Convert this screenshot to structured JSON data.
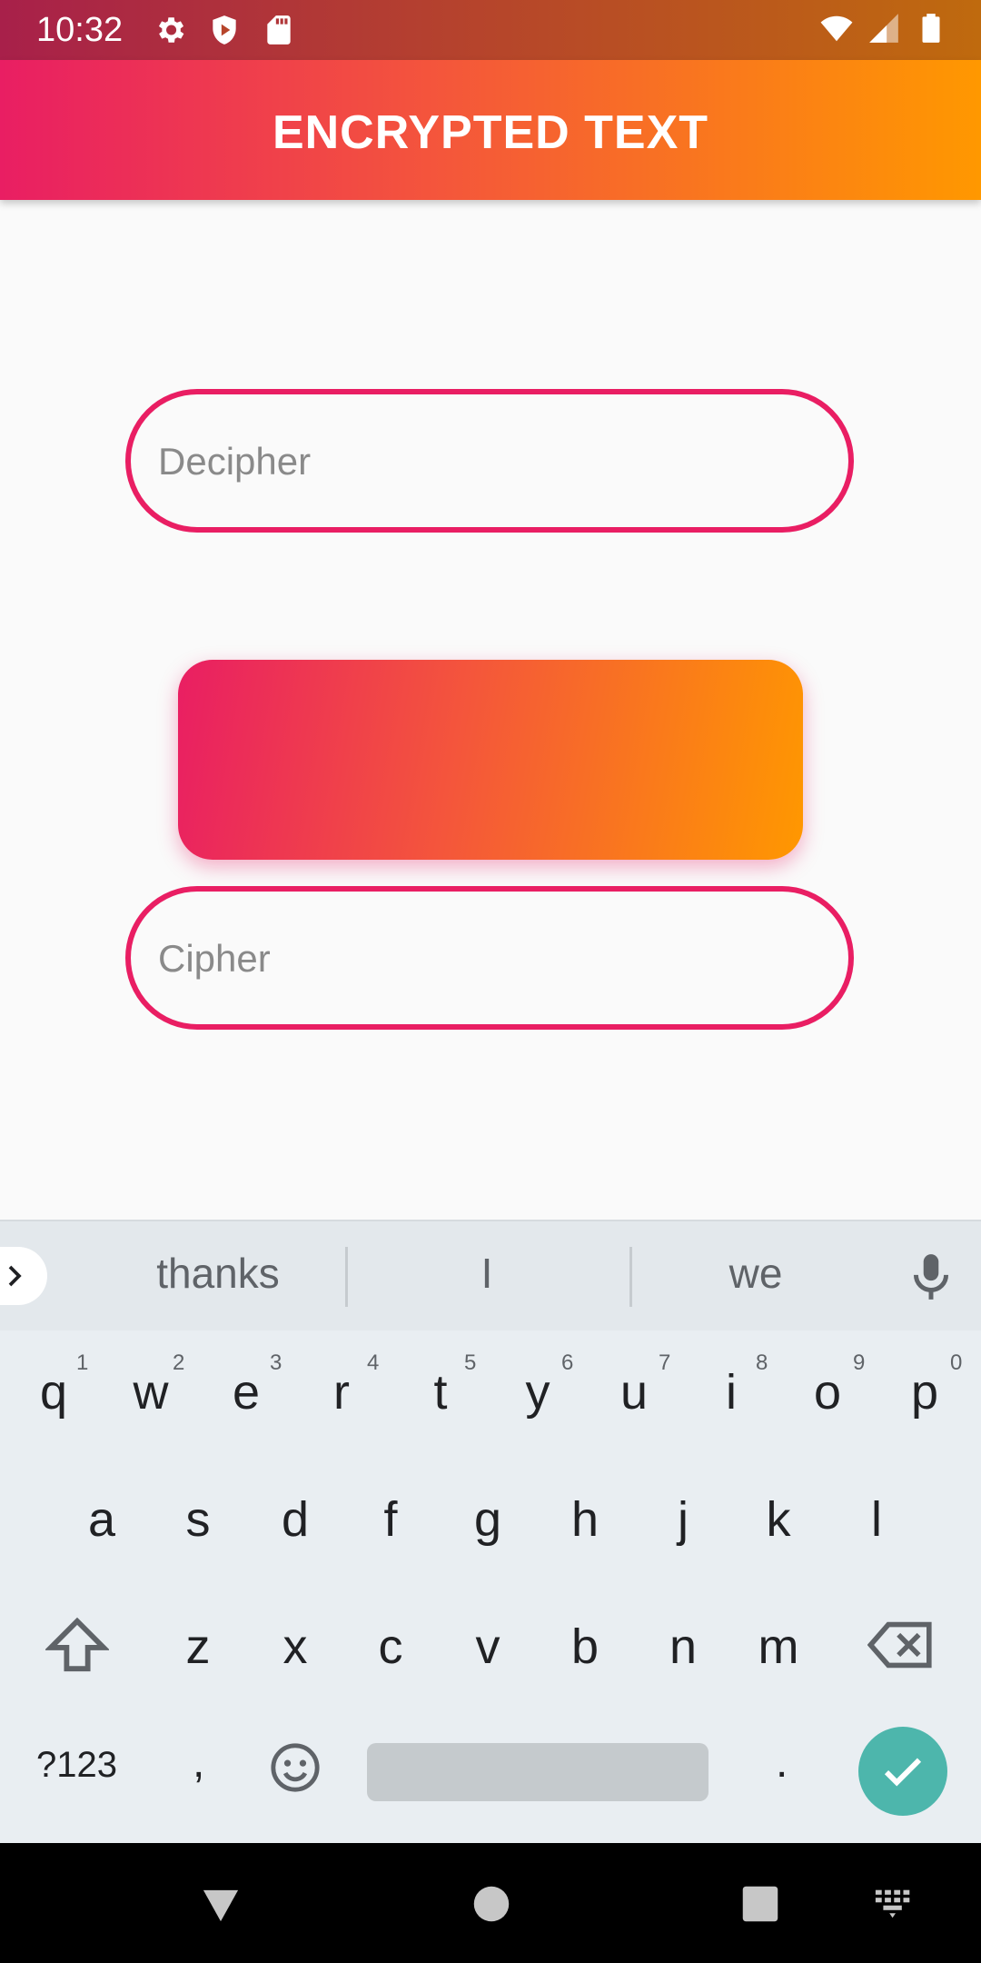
{
  "status_bar": {
    "time": "10:32",
    "icons_left": [
      "settings-icon",
      "shield-play-icon",
      "sd-card-icon"
    ],
    "icons_right": [
      "wifi-icon",
      "cell-signal-icon",
      "battery-icon"
    ]
  },
  "app_bar": {
    "title": "ENCRYPTED TEXT"
  },
  "form": {
    "decipher_placeholder": "Decipher",
    "decipher_value": "",
    "cipher_placeholder": "Cipher",
    "cipher_value": "",
    "action_button_label": ""
  },
  "keyboard": {
    "suggestions": [
      "thanks",
      "I",
      "we"
    ],
    "row1": [
      "q",
      "w",
      "e",
      "r",
      "t",
      "y",
      "u",
      "i",
      "o",
      "p"
    ],
    "row1_hints": [
      "1",
      "2",
      "3",
      "4",
      "5",
      "6",
      "7",
      "8",
      "9",
      "0"
    ],
    "row2": [
      "a",
      "s",
      "d",
      "f",
      "g",
      "h",
      "j",
      "k",
      "l"
    ],
    "row3": [
      "z",
      "x",
      "c",
      "v",
      "b",
      "n",
      "m"
    ],
    "symbols_label": "?123",
    "comma": ",",
    "period": "."
  },
  "colors": {
    "accent_start": "#e91e63",
    "accent_end": "#ff9800",
    "keyboard_bg": "#e9eef2",
    "enter_key": "#4db6ac"
  }
}
